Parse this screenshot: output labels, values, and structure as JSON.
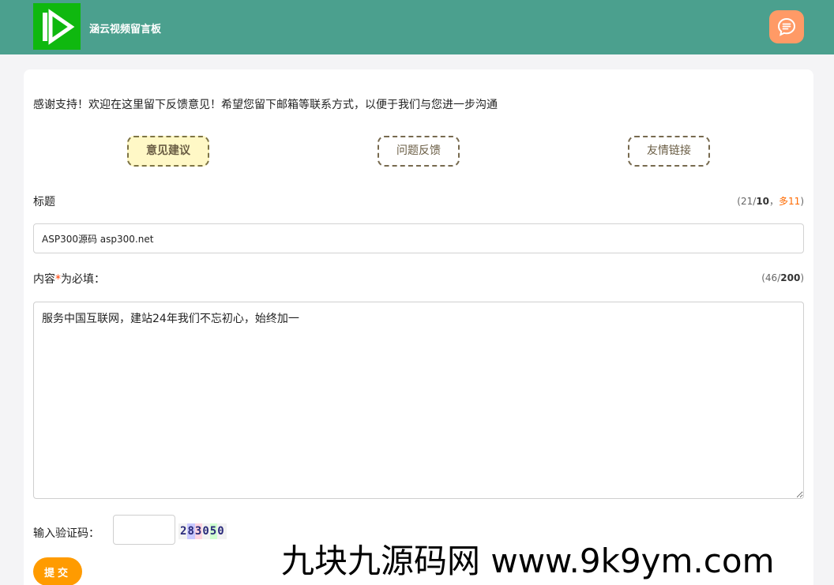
{
  "header": {
    "site_name": "涵云视频留言板",
    "colors": {
      "bar": "#4ba08e",
      "logo": "#0fb80f",
      "message_button": "#ff9a66"
    },
    "logo_icon": "play-logo-icon",
    "message_icon": "chat-bubble-icon"
  },
  "form": {
    "intro": "感谢支持！欢迎在这里留下反馈意见！希望您留下邮箱等联系方式，以便于我们与您进一步沟通",
    "tabs": [
      {
        "label": "意见建议",
        "active": true
      },
      {
        "label": "问题反馈",
        "active": false
      },
      {
        "label": "友情链接",
        "active": false
      }
    ],
    "title_label": "标题",
    "title_counter": {
      "open": "(",
      "count": "21",
      "slash": "/",
      "max": "10",
      "sep": "，",
      "over": "多11",
      "close": ")"
    },
    "title_value": "ASP300源码 asp300.net",
    "content_label_pre": "内容",
    "content_required_mark": "*",
    "content_label_post": "为必填：",
    "content_counter": {
      "open": "(",
      "count": "46",
      "slash": "/",
      "max": "200",
      "close": ")"
    },
    "content_value": "服务中国互联网，建站24年我们不忘初心，始终加一",
    "captcha_label": "输入验证码：",
    "captcha_value": "",
    "captcha_digits": [
      "2",
      "8",
      "3",
      "0",
      "5",
      "0"
    ],
    "submit_label": "提交",
    "accent_color": "#ff9b00"
  },
  "watermark": "九块九源码网 www.9k9ym.com"
}
